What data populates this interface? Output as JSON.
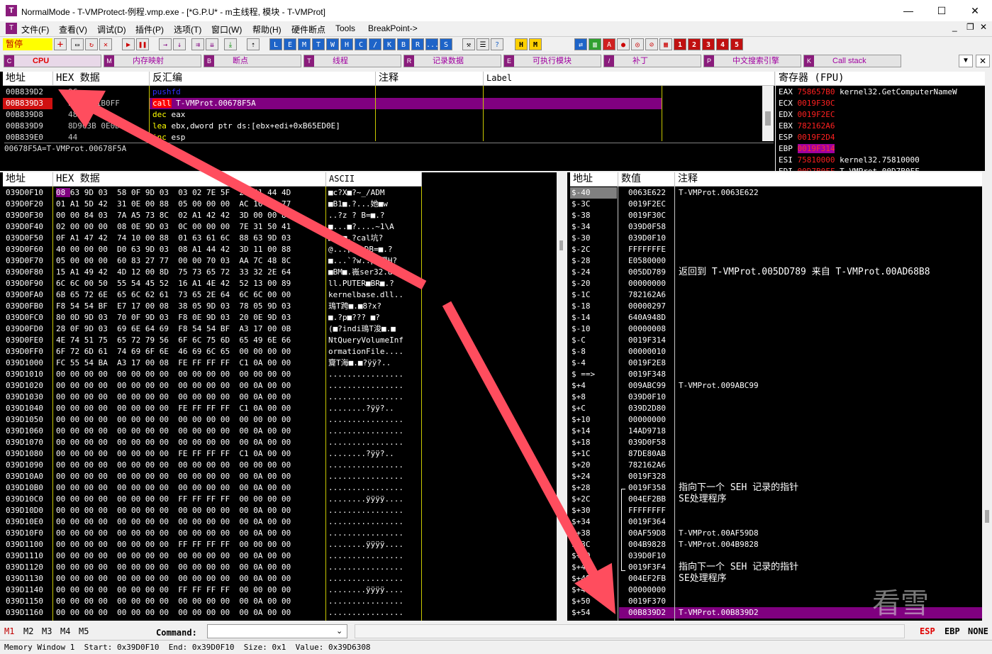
{
  "window": {
    "title": "NormalMode - T-VMProtect-例程.vmp.exe - [*G.P.U* - m主线程, 模块 - T-VMProt]",
    "app_icon_letter": "T",
    "minimize": "—",
    "maximize": "☐",
    "close": "✕",
    "mdi_minimize": "_",
    "mdi_restore": "❐",
    "mdi_close": "✕"
  },
  "menu": [
    "文件(F)",
    "查看(V)",
    "调试(D)",
    "插件(P)",
    "选项(T)",
    "窗口(W)",
    "帮助(H)",
    "硬件断点",
    "Tools",
    "BreakPoint->"
  ],
  "toolbar": {
    "status": "暂停",
    "letter_buttons": [
      "L",
      "E",
      "M",
      "T",
      "W",
      "H",
      "C",
      "/",
      "K",
      "B",
      "R",
      "...",
      "S"
    ],
    "hm_buttons": [
      "H",
      "M"
    ],
    "num_buttons": [
      "1",
      "2",
      "3",
      "4",
      "5"
    ],
    "colors": {
      "status_bg": "#ffff00",
      "status_fg": "#c00000",
      "blue_btn": "#1e64c8",
      "num_btn": "#c01010"
    }
  },
  "tabs": [
    {
      "key": "C",
      "label": "CPU",
      "active": true
    },
    {
      "key": "M",
      "label": "内存映射"
    },
    {
      "key": "B",
      "label": "断点"
    },
    {
      "key": "T",
      "label": "线程"
    },
    {
      "key": "R",
      "label": "记录数据"
    },
    {
      "key": "E",
      "label": "可执行模块"
    },
    {
      "key": "/",
      "label": "补丁"
    },
    {
      "key": "P",
      "label": "中文搜索引擎"
    },
    {
      "key": "K",
      "label": "Call stack"
    }
  ],
  "disasm": {
    "headers": [
      "地址",
      "HEX 数据",
      "反汇编",
      "注释",
      "Label"
    ],
    "rows": [
      {
        "addr": "00B839D2",
        "hex": "9C",
        "asm": "pushfd",
        "op_color": "#3030ff",
        "selected": false
      },
      {
        "addr": "00B839D3",
        "hex": "E8 82A1B0FF",
        "asm": "call T-VMProt.00678F5A",
        "selected": true
      },
      {
        "addr": "00B839D8",
        "hex": "48",
        "asm": "dec eax",
        "selected": false
      },
      {
        "addr": "00B839D9",
        "hex": "8D9C3B 0E0DB6",
        "asm": "lea ebx,dword ptr ds:[ebx+edi+0xB65ED0E]",
        "selected": false
      },
      {
        "addr": "00B839E0",
        "hex": "44",
        "asm": "inc esp",
        "selected": false
      }
    ],
    "info_line": "00678F5A=T-VMProt.00678F5A"
  },
  "registers": {
    "title": "寄存器 (FPU)",
    "rows": [
      {
        "name": "EAX",
        "value": "758657B0",
        "comment": "kernel32.GetComputerNameW"
      },
      {
        "name": "ECX",
        "value": "0019F30C",
        "comment": ""
      },
      {
        "name": "EDX",
        "value": "0019F2EC",
        "comment": ""
      },
      {
        "name": "EBX",
        "value": "782162A6",
        "comment": ""
      },
      {
        "name": "ESP",
        "value": "0019F2D4",
        "comment": ""
      },
      {
        "name": "EBP",
        "value": "0019F314",
        "comment": "",
        "highlight": true
      },
      {
        "name": "ESI",
        "value": "75810000",
        "comment": "kernel32.75810000"
      },
      {
        "name": "EDI",
        "value": "00D7B0FF",
        "comment": "T-VMProt.00D7B0FF"
      }
    ]
  },
  "dump": {
    "headers": [
      "地址",
      "HEX 数据",
      "ASCII"
    ],
    "rows": [
      {
        "addr": "039D0F10",
        "hex": "08 63 9D 03 58 0F 9D 03 03 02 7E 5F 2F 41 44 4D",
        "ascii": "■c?X■?~_/ADM"
      },
      {
        "addr": "039D0F20",
        "hex": "01 A1 5D 42 31 0E 00 88 05 00 00 00 AC 10 10 77",
        "ascii": "■B1■.?...她■w"
      },
      {
        "addr": "039D0F30",
        "hex": "00 00 84 03 7A A5 73 8C 02 A1 42 42 3D 00 00 8C",
        "ascii": "..?z ? B=■.?"
      },
      {
        "addr": "039D0F40",
        "hex": "02 00 00 00 08 0E 9D 03 0C 00 00 00 7E 31 50 41",
        "ascii": "■...■?....~1\\A"
      },
      {
        "addr": "039D0F50",
        "hex": "0F A1 47 42 74 10 00 88 01 63 61 6C 88 63 9D 03",
        "ascii": "■Bt■.?cal坑?"
      },
      {
        "addr": "039D0F60",
        "hex": "40 00 00 00 D0 63 9D 03 08 A1 44 42 3D 11 00 88",
        "ascii": "@...衏?■DB=■.?"
      },
      {
        "addr": "039D0F70",
        "hex": "05 00 00 00 60 83 27 77 00 00 70 03 AA 7C 48 8C",
        "ascii": "■...`?w..p■獏H?"
      },
      {
        "addr": "039D0F80",
        "hex": "15 A1 49 42 4D 12 00 8D 75 73 65 72 33 32 2E 64",
        "ascii": "■BM■.嶶ser32.d"
      },
      {
        "addr": "039D0F90",
        "hex": "6C 6C 00 50 55 54 45 52 16 A1 4E 42 52 13 00 89",
        "ascii": "ll.PUTER■BR■.?"
      },
      {
        "addr": "039D0FA0",
        "hex": "6B 65 72 6E 65 6C 62 61 73 65 2E 64 6C 6C 00 00",
        "ascii": "kernelbase.dll.."
      },
      {
        "addr": "039D0FB0",
        "hex": "F8 54 54 BF E7 17 00 08 38 05 9D 03 78 05 9D 03",
        "ascii": "鳿T跨■.■8?x?"
      },
      {
        "addr": "039D0FC0",
        "hex": "80 0D 9D 03 70 0F 9D 03 F8 0E 9D 03 20 0E 9D 03",
        "ascii": "■.?p■??? ■?"
      },
      {
        "addr": "039D0FD0",
        "hex": "28 0F 9D 03 69 6E 64 69 F8 54 54 BF A3 17 00 0B",
        "ascii": "(■?indi鳿T浚■.■"
      },
      {
        "addr": "039D0FE0",
        "hex": "4E 74 51 75 65 72 79 56 6F 6C 75 6D 65 49 6E 66",
        "ascii": "NtQueryVolumeInf"
      },
      {
        "addr": "039D0FF0",
        "hex": "6F 72 6D 61 74 69 6F 6E 46 69 6C 65 00 00 00 00",
        "ascii": "ormationFile...."
      },
      {
        "addr": "039D1000",
        "hex": "FC 55 54 BA A3 17 00 08 FE FF FF FF C1 0A 00 00",
        "ascii": "齎T海■.■?ÿÿ?.."
      },
      {
        "addr": "039D1010",
        "hex": "00 00 00 00 00 00 00 00 00 00 00 00 00 00 00 00",
        "ascii": "................"
      },
      {
        "addr": "039D1020",
        "hex": "00 00 00 00 00 00 00 00 00 00 00 00 00 0A 00 00",
        "ascii": "................"
      },
      {
        "addr": "039D1030",
        "hex": "00 00 00 00 00 00 00 00 00 00 00 00 00 0A 00 00",
        "ascii": "................"
      },
      {
        "addr": "039D1040",
        "hex": "00 00 00 00 00 00 00 00 FE FF FF FF C1 0A 00 00",
        "ascii": "........?ÿÿ?.."
      },
      {
        "addr": "039D1050",
        "hex": "00 00 00 00 00 00 00 00 00 00 00 00 00 00 00 00",
        "ascii": "................"
      },
      {
        "addr": "039D1060",
        "hex": "00 00 00 00 00 00 00 00 00 00 00 00 00 0A 00 00",
        "ascii": "................"
      },
      {
        "addr": "039D1070",
        "hex": "00 00 00 00 00 00 00 00 00 00 00 00 00 0A 00 00",
        "ascii": "................"
      },
      {
        "addr": "039D1080",
        "hex": "00 00 00 00 00 00 00 00 FE FF FF FF C1 0A 00 00",
        "ascii": "........?ÿÿ?.."
      },
      {
        "addr": "039D1090",
        "hex": "00 00 00 00 00 00 00 00 00 00 00 00 00 00 00 00",
        "ascii": "................"
      },
      {
        "addr": "039D10A0",
        "hex": "00 00 00 00 00 00 00 00 00 00 00 00 00 0A 00 00",
        "ascii": "................"
      },
      {
        "addr": "039D10B0",
        "hex": "00 00 00 00 00 00 00 00 00 00 00 00 00 0A 00 00",
        "ascii": "................"
      },
      {
        "addr": "039D10C0",
        "hex": "00 00 00 00 00 00 00 00 FF FF FF FF 00 00 00 00",
        "ascii": "........ÿÿÿÿ...."
      },
      {
        "addr": "039D10D0",
        "hex": "00 00 00 00 00 00 00 00 00 00 00 00 00 0A 00 00",
        "ascii": "................"
      },
      {
        "addr": "039D10E0",
        "hex": "00 00 00 00 00 00 00 00 00 00 00 00 00 0A 00 00",
        "ascii": "................"
      },
      {
        "addr": "039D10F0",
        "hex": "00 00 00 00 00 00 00 00 00 00 00 00 00 0A 00 00",
        "ascii": "................"
      },
      {
        "addr": "039D1100",
        "hex": "00 00 00 00 00 00 00 00 FF FF FF FF 00 00 00 00",
        "ascii": "........ÿÿÿÿ...."
      },
      {
        "addr": "039D1110",
        "hex": "00 00 00 00 00 00 00 00 00 00 00 00 00 0A 00 00",
        "ascii": "................"
      },
      {
        "addr": "039D1120",
        "hex": "00 00 00 00 00 00 00 00 00 00 00 00 00 0A 00 00",
        "ascii": "................"
      },
      {
        "addr": "039D1130",
        "hex": "00 00 00 00 00 00 00 00 00 00 00 00 00 0A 00 00",
        "ascii": "................"
      },
      {
        "addr": "039D1140",
        "hex": "00 00 00 00 00 00 00 00 FF FF FF FF 00 00 00 00",
        "ascii": "........ÿÿÿÿ...."
      },
      {
        "addr": "039D1150",
        "hex": "00 00 00 00 00 00 00 00 00 00 00 00 00 0A 00 00",
        "ascii": "................"
      },
      {
        "addr": "039D1160",
        "hex": "00 00 00 00 00 00 00 00 00 00 00 00 00 0A 00 00",
        "ascii": "................"
      }
    ]
  },
  "stack": {
    "headers": [
      "地址",
      "数值",
      "注释"
    ],
    "rows": [
      {
        "off": "$-40",
        "val": "0063E622",
        "cmt": "T-VMProt.0063E622",
        "top": true
      },
      {
        "off": "$-3C",
        "val": "0019F2EC",
        "cmt": ""
      },
      {
        "off": "$-38",
        "val": "0019F30C",
        "cmt": ""
      },
      {
        "off": "$-34",
        "val": "039D0F58",
        "cmt": ""
      },
      {
        "off": "$-30",
        "val": "039D0F10",
        "cmt": ""
      },
      {
        "off": "$-2C",
        "val": "FFFFFFFE",
        "cmt": ""
      },
      {
        "off": "$-28",
        "val": "E0580000",
        "cmt": ""
      },
      {
        "off": "$-24",
        "val": "005DD789",
        "cmt": "返回到 T-VMProt.005DD789 来自 T-VMProt.00AD68B8"
      },
      {
        "off": "$-20",
        "val": "00000000",
        "cmt": ""
      },
      {
        "off": "$-1C",
        "val": "782162A6",
        "cmt": ""
      },
      {
        "off": "$-18",
        "val": "00000297",
        "cmt": ""
      },
      {
        "off": "$-14",
        "val": "640A948D",
        "cmt": ""
      },
      {
        "off": "$-10",
        "val": "00000008",
        "cmt": ""
      },
      {
        "off": "$-C",
        "val": "0019F314",
        "cmt": ""
      },
      {
        "off": "$-8",
        "val": "00000010",
        "cmt": ""
      },
      {
        "off": "$-4",
        "val": "0019F2E8",
        "cmt": ""
      },
      {
        "off": "$ ==>",
        "val": "0019F348",
        "cmt": ""
      },
      {
        "off": "$+4",
        "val": "009ABC99",
        "cmt": "T-VMProt.009ABC99"
      },
      {
        "off": "$+8",
        "val": "039D0F10",
        "cmt": ""
      },
      {
        "off": "$+C",
        "val": "039D2D80",
        "cmt": ""
      },
      {
        "off": "$+10",
        "val": "00000000",
        "cmt": ""
      },
      {
        "off": "$+14",
        "val": "14AD9718",
        "cmt": ""
      },
      {
        "off": "$+18",
        "val": "039D0F58",
        "cmt": ""
      },
      {
        "off": "$+1C",
        "val": "87DE80AB",
        "cmt": ""
      },
      {
        "off": "$+20",
        "val": "782162A6",
        "cmt": ""
      },
      {
        "off": "$+24",
        "val": "0019F328",
        "cmt": ""
      },
      {
        "off": "$+28",
        "val": "0019F358",
        "cmt": "指向下一个 SEH 记录的指针"
      },
      {
        "off": "$+2C",
        "val": "004EF2BB",
        "cmt": "SE处理程序"
      },
      {
        "off": "$+30",
        "val": "FFFFFFFF",
        "cmt": ""
      },
      {
        "off": "$+34",
        "val": "0019F364",
        "cmt": ""
      },
      {
        "off": "$+38",
        "val": "00AF59D8",
        "cmt": "T-VMProt.00AF59D8"
      },
      {
        "off": "$+3C",
        "val": "004B9828",
        "cmt": "T-VMProt.004B9828"
      },
      {
        "off": "$+40",
        "val": "039D0F10",
        "cmt": ""
      },
      {
        "off": "$+44",
        "val": "0019F3F4",
        "cmt": "指向下一个 SEH 记录的指针"
      },
      {
        "off": "$+48",
        "val": "004EF2FB",
        "cmt": "SE处理程序"
      },
      {
        "off": "$+4C",
        "val": "00000000",
        "cmt": ""
      },
      {
        "off": "$+50",
        "val": "0019F370",
        "cmt": ""
      },
      {
        "off": "$+54",
        "val": "00B839D2",
        "cmt": "T-VMProt.00B839D2",
        "selected": true
      }
    ]
  },
  "command_bar": {
    "markers": [
      "M1",
      "M2",
      "M3",
      "M4",
      "M5"
    ],
    "command_label": "Command:",
    "command_value": "",
    "right": [
      "ESP",
      "EBP",
      "NONE"
    ]
  },
  "status": "Memory Window 1  Start: 0x39D0F10  End: 0x39D0F10  Size: 0x1  Value: 0x39D6308",
  "watermark": "看雪",
  "annotation_color": "#ff4d5e"
}
